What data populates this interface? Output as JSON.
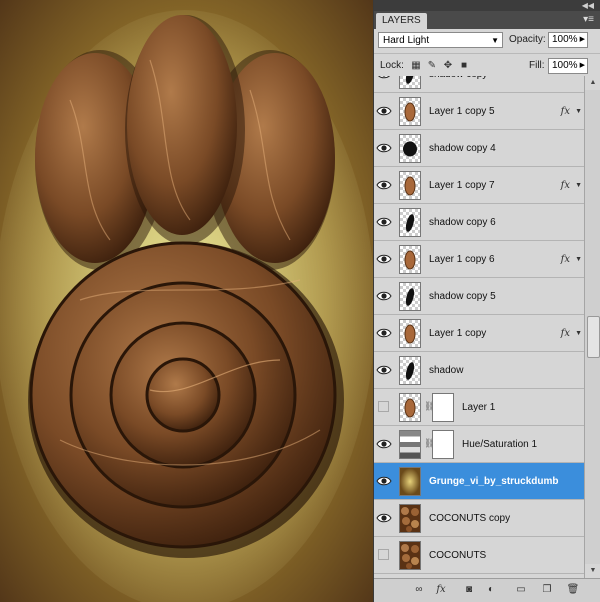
{
  "panel": {
    "title": "LAYERS",
    "collapse_icon": "double-arrow-icon",
    "menu_icon": "panel-menu-icon"
  },
  "blend": {
    "mode": "Hard Light"
  },
  "opacity": {
    "label": "Opacity:",
    "value": "100%"
  },
  "lock": {
    "label": "Lock:",
    "icons": [
      "lock-transparent-icon",
      "lock-paint-icon",
      "lock-move-icon",
      "lock-all-icon"
    ]
  },
  "fill": {
    "label": "Fill:",
    "value": "100%"
  },
  "layers": [
    {
      "name": "shadow copy",
      "visible": true,
      "thumb": "shadow",
      "fx": false
    },
    {
      "name": "Layer 1 copy 5",
      "visible": true,
      "thumb": "coconut",
      "fx": true
    },
    {
      "name": "shadow copy 4",
      "visible": true,
      "thumb": "shadow-round",
      "fx": false
    },
    {
      "name": "Layer 1 copy 7",
      "visible": true,
      "thumb": "coconut",
      "fx": true
    },
    {
      "name": "shadow copy 6",
      "visible": true,
      "thumb": "shadow",
      "fx": false
    },
    {
      "name": "Layer 1 copy 6",
      "visible": true,
      "thumb": "coconut",
      "fx": true
    },
    {
      "name": "shadow copy 5",
      "visible": true,
      "thumb": "shadow",
      "fx": false
    },
    {
      "name": "Layer 1 copy",
      "visible": true,
      "thumb": "coconut",
      "fx": true
    },
    {
      "name": "shadow",
      "visible": true,
      "thumb": "shadow",
      "fx": false
    },
    {
      "name": "Layer 1",
      "visible": false,
      "thumb": "coconut",
      "fx": false,
      "mask": true
    },
    {
      "name": "Hue/Saturation 1",
      "visible": true,
      "thumb": "adjustment",
      "fx": false,
      "mask": true
    },
    {
      "name": "Grunge_vi_by_struckdumb",
      "visible": true,
      "thumb": "grunge",
      "fx": false,
      "selected": true
    },
    {
      "name": "COCONUTS copy",
      "visible": true,
      "thumb": "coconuts",
      "fx": false
    },
    {
      "name": "COCONUTS",
      "visible": false,
      "thumb": "coconuts",
      "fx": false
    }
  ],
  "fx_label": "fx",
  "footer_icons": [
    "link-layers-icon",
    "fx-icon",
    "mask-icon",
    "adjustment-icon",
    "folder-icon",
    "new-layer-icon",
    "trash-icon"
  ],
  "colors": {
    "selected": "#3b8edc",
    "panel": "#d6d6d6",
    "header": "#4a4a4a"
  }
}
